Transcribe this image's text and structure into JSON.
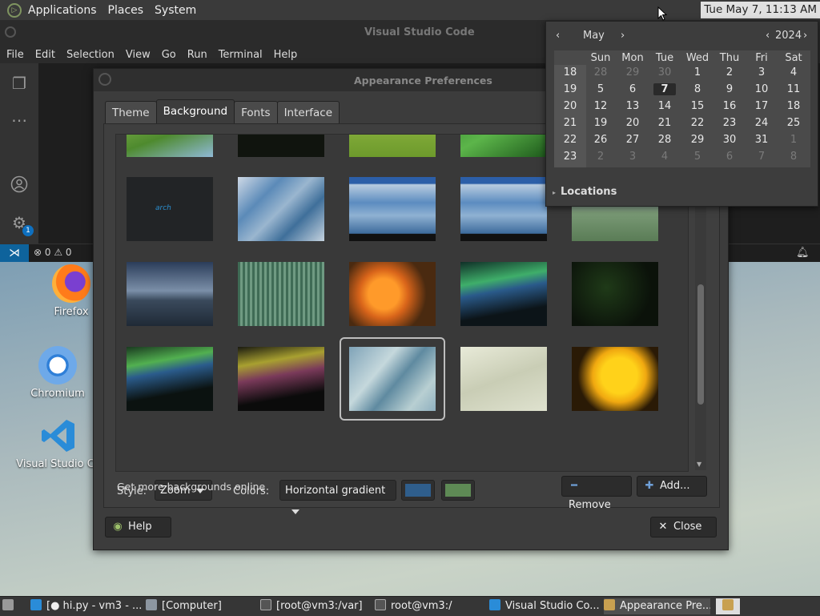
{
  "top_panel": {
    "menus": [
      "Applications",
      "Places",
      "System"
    ],
    "clock": "Tue May  7, 11:13 AM"
  },
  "vscode": {
    "title": "Visual Studio Code",
    "menus": [
      "File",
      "Edit",
      "Selection",
      "View",
      "Go",
      "Run",
      "Terminal",
      "Help"
    ],
    "badge": "1",
    "problems": "⊗ 0 ⚠ 0"
  },
  "desktop": {
    "icons": [
      {
        "label": "Firefox",
        "icon": "firefox-icon"
      },
      {
        "label": "Chromium",
        "icon": "chromium-icon"
      },
      {
        "label": "Visual Studio Co",
        "icon": "vscode-icon"
      }
    ]
  },
  "dialog": {
    "title": "Appearance Preferences",
    "tabs": [
      "Theme",
      "Background",
      "Fonts",
      "Interface"
    ],
    "active_tab": "Background",
    "style_label": "Style:",
    "style_value": "Zoom",
    "colors_label": "Colors:",
    "colors_value": "Horizontal gradient",
    "color1": "#2f5e8c",
    "color2": "#5e8a55",
    "more_link": "Get more backgrounds online",
    "remove_label": "Remove",
    "add_label": "Add...",
    "help_label": "Help",
    "close_label": "Close",
    "archlinux_text": "arch"
  },
  "calendar": {
    "month": "May",
    "year": "2024",
    "weekdays": [
      "Sun",
      "Mon",
      "Tue",
      "Wed",
      "Thu",
      "Fri",
      "Sat"
    ],
    "weeks": [
      {
        "num": "18",
        "days": [
          "28",
          "29",
          "30",
          "1",
          "2",
          "3",
          "4"
        ],
        "dim": [
          true,
          true,
          true,
          false,
          false,
          false,
          false
        ]
      },
      {
        "num": "19",
        "days": [
          "5",
          "6",
          "7",
          "8",
          "9",
          "10",
          "11"
        ],
        "dim": [
          false,
          false,
          false,
          false,
          false,
          false,
          false
        ]
      },
      {
        "num": "20",
        "days": [
          "12",
          "13",
          "14",
          "15",
          "16",
          "17",
          "18"
        ],
        "dim": [
          false,
          false,
          false,
          false,
          false,
          false,
          false
        ]
      },
      {
        "num": "21",
        "days": [
          "19",
          "20",
          "21",
          "22",
          "23",
          "24",
          "25"
        ],
        "dim": [
          false,
          false,
          false,
          false,
          false,
          false,
          false
        ]
      },
      {
        "num": "22",
        "days": [
          "26",
          "27",
          "28",
          "29",
          "30",
          "31",
          "1"
        ],
        "dim": [
          false,
          false,
          false,
          false,
          false,
          false,
          true
        ]
      },
      {
        "num": "23",
        "days": [
          "2",
          "3",
          "4",
          "5",
          "6",
          "7",
          "8"
        ],
        "dim": [
          true,
          true,
          true,
          true,
          true,
          true,
          true
        ]
      }
    ],
    "today": "7",
    "locations": "Locations"
  },
  "taskbar": {
    "items": [
      {
        "label": "[● hi.py - vm3 - ...",
        "icon": "vscode-icon"
      },
      {
        "label": "[Computer]",
        "icon": "computer-icon"
      },
      {
        "label": "[root@vm3:/var]",
        "icon": "terminal-icon"
      },
      {
        "label": "root@vm3:/",
        "icon": "terminal-icon"
      },
      {
        "label": "Visual Studio Co...",
        "icon": "vscode-icon"
      },
      {
        "label": "Appearance Pre...",
        "icon": "appearance-icon"
      }
    ]
  }
}
